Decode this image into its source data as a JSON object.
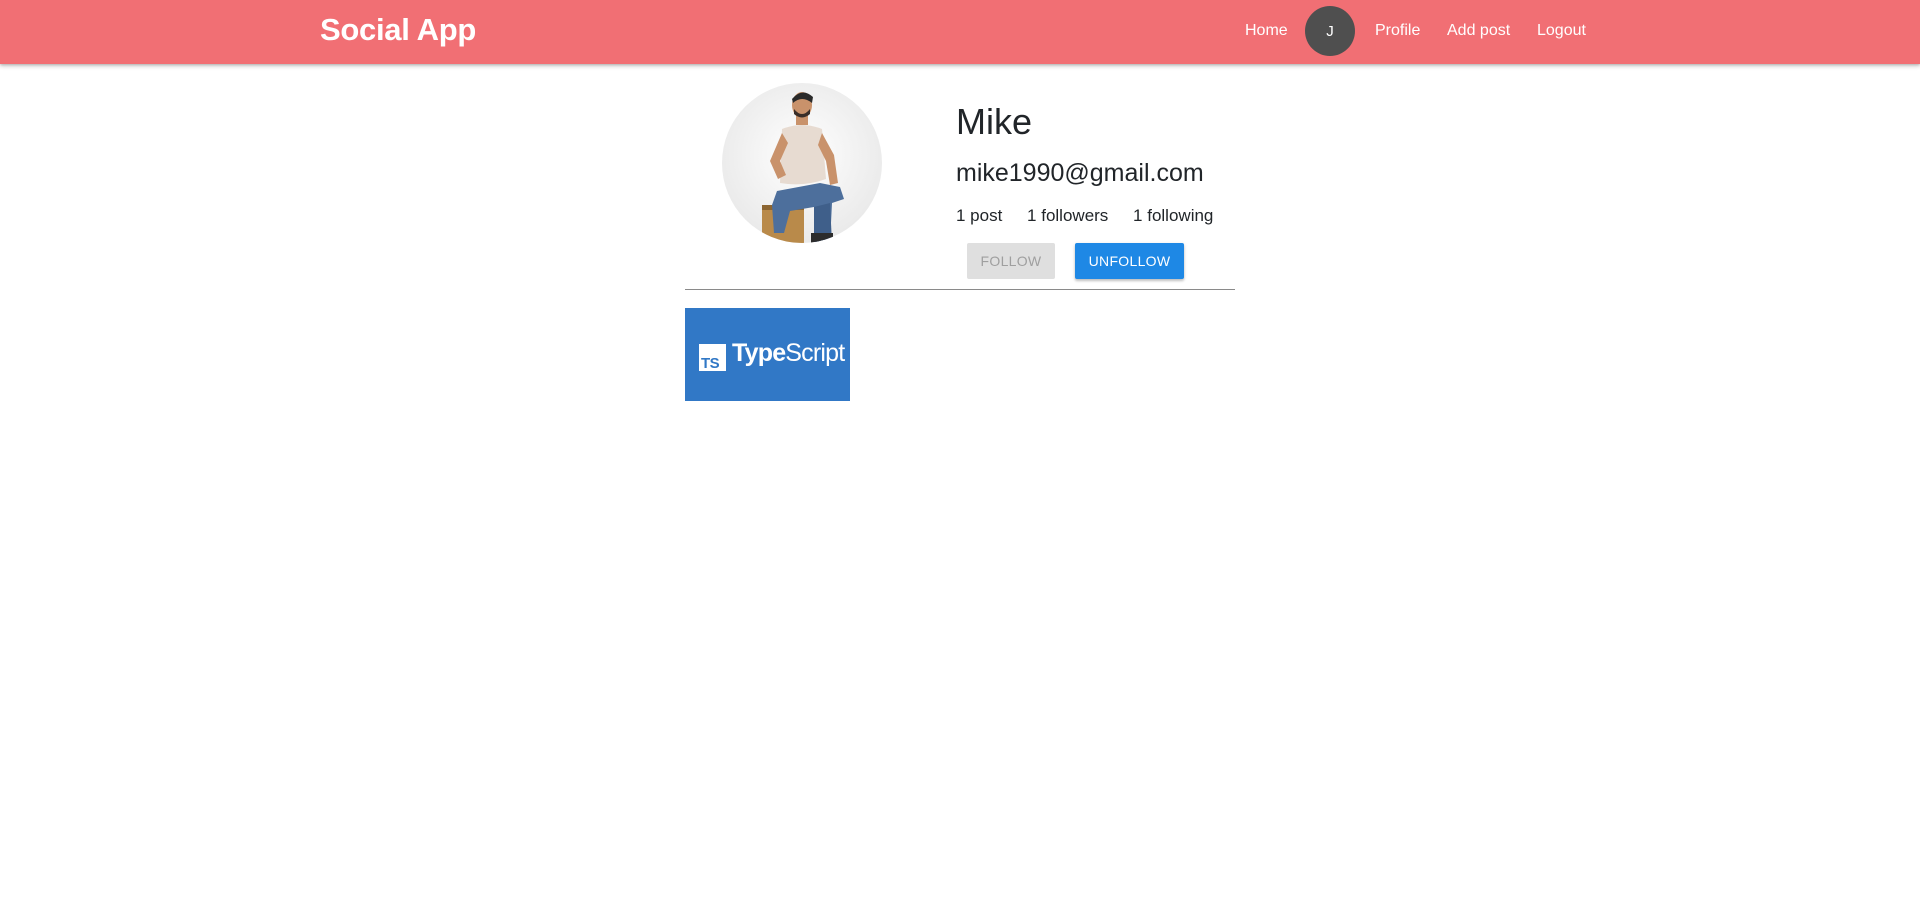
{
  "navbar": {
    "brand": "Social App",
    "links": {
      "home": "Home",
      "profile": "Profile",
      "add_post": "Add post",
      "logout": "Logout"
    },
    "avatar_initial": "J",
    "background_color": "#f16f74"
  },
  "profile": {
    "name": "Mike",
    "email": "mike1990@gmail.com",
    "stats": {
      "posts": "1 post",
      "followers": "1 followers",
      "following": "1 following"
    },
    "buttons": {
      "follow": "FOLLOW",
      "unfollow": "UNFOLLOW"
    },
    "photo_icon": "person-photo"
  },
  "posts": [
    {
      "thumbnail_logo_box": "TS",
      "thumbnail_logo_word_bold": "Type",
      "thumbnail_logo_word_regular": "Script",
      "background_color": "#3178c6"
    }
  ],
  "colors": {
    "accent": "#1e88e5",
    "disabled_button": "#dfdfdf"
  }
}
